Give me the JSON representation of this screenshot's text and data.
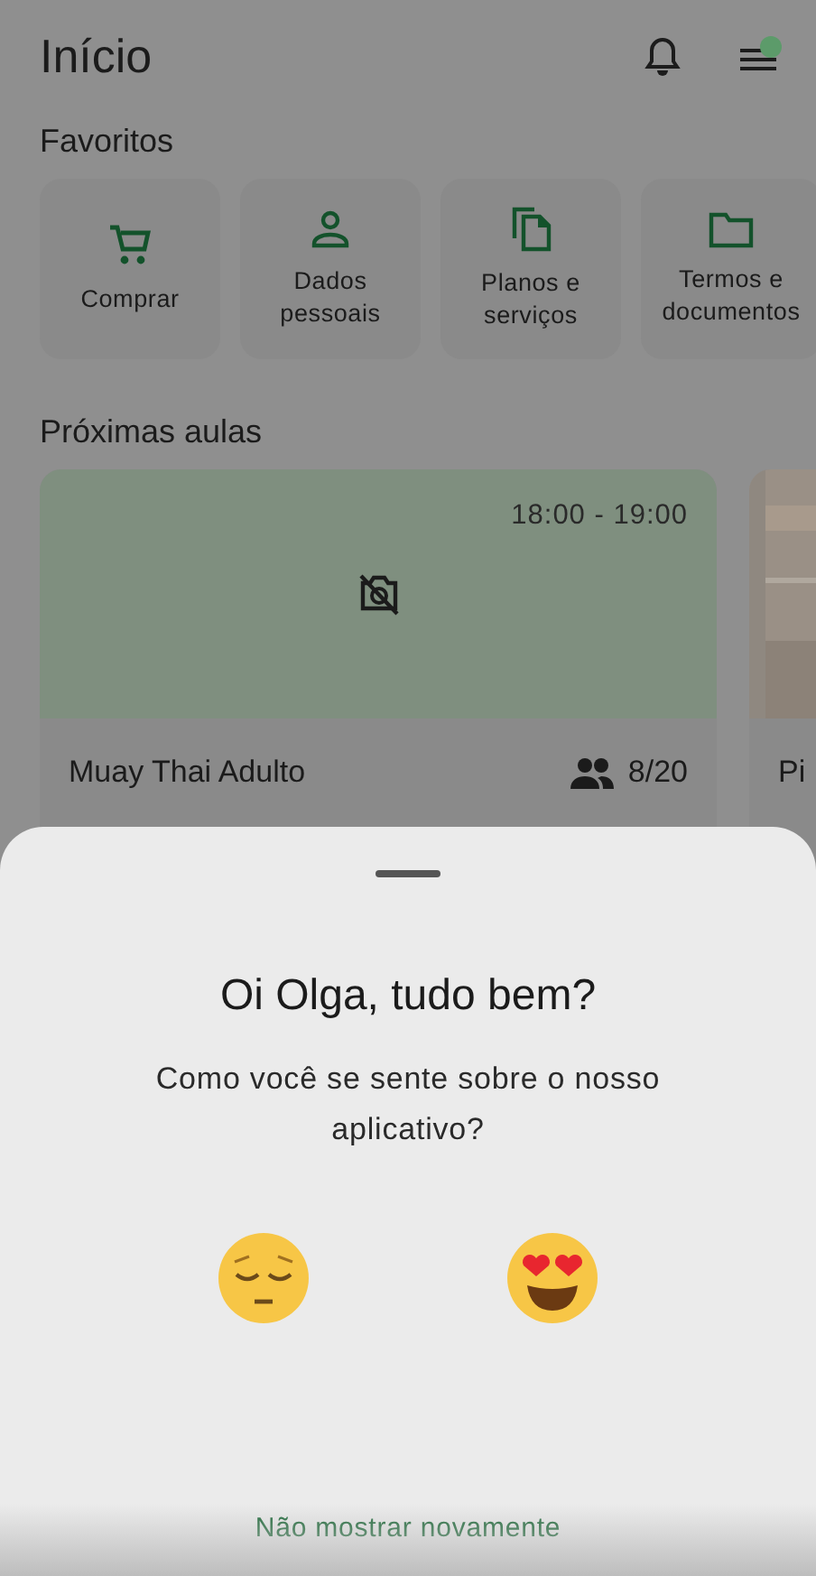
{
  "header": {
    "title": "Início"
  },
  "favorites": {
    "title": "Favoritos",
    "items": [
      {
        "label": "Comprar",
        "kind": "cart"
      },
      {
        "label": "Dados pessoais",
        "kind": "person"
      },
      {
        "label": "Planos e serviços",
        "kind": "copy"
      },
      {
        "label": "Termos e documentos",
        "kind": "folder"
      }
    ]
  },
  "classes": {
    "title": "Próximas aulas",
    "items": [
      {
        "kind": "no-photo",
        "time": "18:00 - 19:00",
        "name": "Muay Thai Adulto",
        "occupancy": "8/20"
      },
      {
        "kind": "picture",
        "name": "Pi"
      }
    ]
  },
  "sheet": {
    "title": "Oi Olga, tudo bem?",
    "question": "Como você se sente sobre o nosso aplicativo?",
    "reactions": [
      {
        "kind": "sad"
      },
      {
        "kind": "love"
      }
    ],
    "dismiss": "Não mostrar novamente"
  }
}
